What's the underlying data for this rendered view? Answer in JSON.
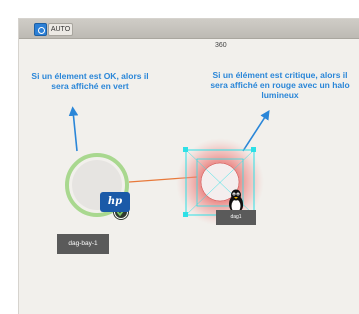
{
  "toolbar": {
    "mode_icon": "refresh-icon",
    "auto_label": "AUTO"
  },
  "view": {
    "zoom_value": "360"
  },
  "annotations": {
    "ok_text": "Si un élement est OK, alors il sera affiché en vert",
    "critical_text": "Si un élément est critique, alors il sera affiché en rouge avec un halo lumineux"
  },
  "nodes": {
    "ok_node": {
      "label": "dag-bay-1",
      "icon": "hp-logo-icon",
      "logo_text": "hp",
      "status": "ok",
      "status_icon": "checkmark-badge-icon",
      "ring_color": "#9ad37e"
    },
    "critical_node": {
      "label": "dag1",
      "icon": "linux-tux-icon",
      "status": "critical",
      "status_icon": "cross-badge-icon",
      "halo_color": "#e8605e",
      "selection_color": "#2ee0e6"
    },
    "link": {
      "color": "#e8793a"
    }
  },
  "colors": {
    "annotation_blue": "#2a86d8",
    "canvas_bg": "#f2f0ec"
  }
}
